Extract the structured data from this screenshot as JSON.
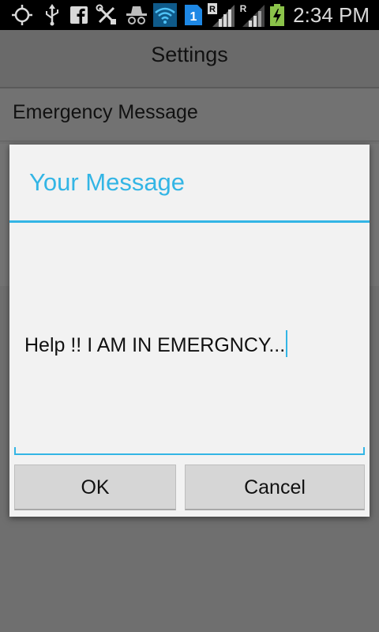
{
  "status_bar": {
    "time": "2:34 PM",
    "icons": [
      "gps-icon",
      "usb-icon",
      "facebook-icon",
      "tools-icon",
      "incognito-icon",
      "wifi-icon",
      "sim-1-icon",
      "roaming-signal-icon",
      "roaming-signal-2-icon",
      "battery-charging-icon"
    ],
    "roaming_letter": "R",
    "sim_number": "1"
  },
  "app_bar": {
    "title": "Settings"
  },
  "list": {
    "item_label": "Emergency Message"
  },
  "dialog": {
    "title": "Your Message",
    "message_value": "Help !! I AM IN EMERGNCY...",
    "ok_label": "OK",
    "cancel_label": "Cancel"
  },
  "colors": {
    "accent": "#33b5e5",
    "status_bar_bg": "#000000",
    "dialog_bg": "#f2f2f2"
  }
}
